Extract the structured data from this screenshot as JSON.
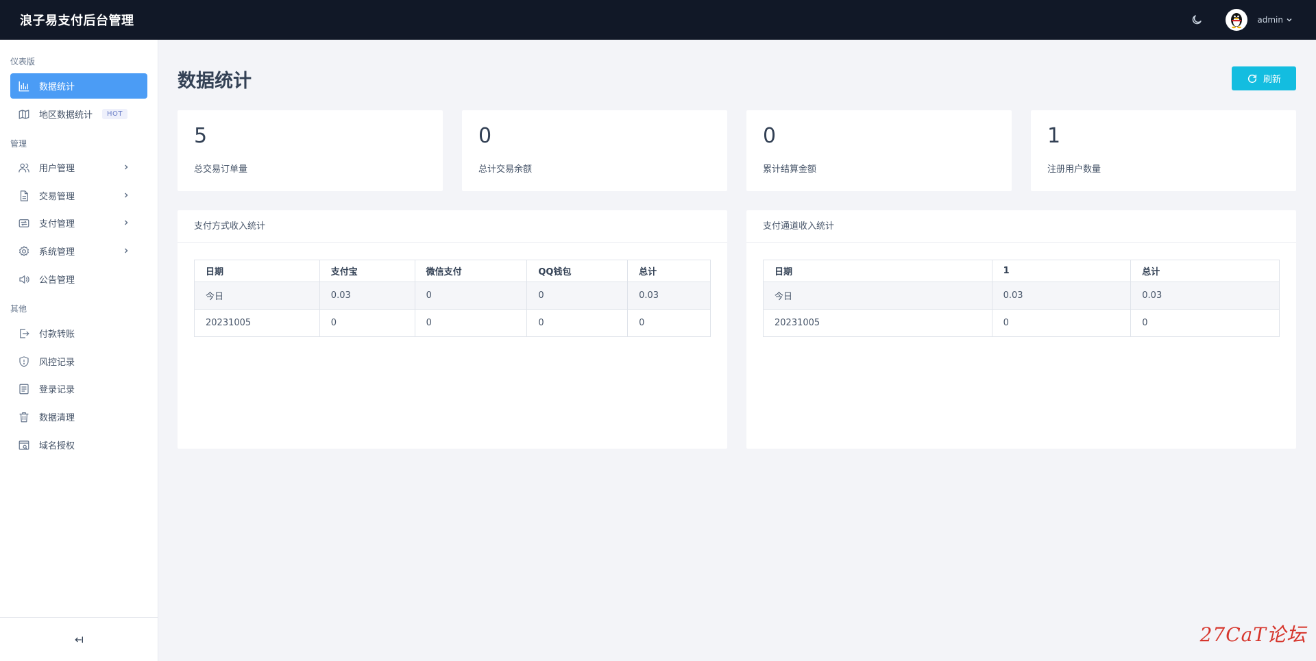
{
  "header": {
    "title": "浪子易支付后台管理",
    "user": "admin",
    "icons": {
      "theme": "moon-icon",
      "avatar": "penguin-avatar",
      "dropdown": "chevron-down-icon"
    }
  },
  "sidebar": {
    "sections": [
      "仪表版",
      "管理",
      "其他"
    ],
    "items": [
      {
        "label": "数据统计",
        "icon": "bar-chart-icon",
        "active": true
      },
      {
        "label": "地区数据统计",
        "icon": "map-icon",
        "badge": "HOT"
      },
      {
        "label": "用户管理",
        "icon": "users-icon",
        "expandable": true
      },
      {
        "label": "交易管理",
        "icon": "document-icon",
        "expandable": true
      },
      {
        "label": "支付管理",
        "icon": "transfer-icon",
        "expandable": true
      },
      {
        "label": "系统管理",
        "icon": "gear-icon",
        "expandable": true
      },
      {
        "label": "公告管理",
        "icon": "speaker-icon"
      },
      {
        "label": "付款转账",
        "icon": "export-icon"
      },
      {
        "label": "风控记录",
        "icon": "shield-icon"
      },
      {
        "label": "登录记录",
        "icon": "list-icon"
      },
      {
        "label": "数据清理",
        "icon": "trash-icon"
      },
      {
        "label": "域名授权",
        "icon": "domain-icon"
      }
    ],
    "collapse_icon": "collapse-left-icon"
  },
  "main": {
    "title": "数据统计",
    "refresh_label": "刷新",
    "stats": [
      {
        "value": "5",
        "label": "总交易订单量"
      },
      {
        "value": "0",
        "label": "总计交易余额"
      },
      {
        "value": "0",
        "label": "累计结算金额"
      },
      {
        "value": "1",
        "label": "注册用户数量"
      }
    ],
    "payment_method_table": {
      "title": "支付方式收入统计",
      "columns": [
        "日期",
        "支付宝",
        "微信支付",
        "QQ钱包",
        "总计"
      ],
      "rows": [
        [
          "今日",
          "0.03",
          "0",
          "0",
          "0.03"
        ],
        [
          "20231005",
          "0",
          "0",
          "0",
          "0"
        ]
      ]
    },
    "channel_table": {
      "title": "支付通道收入统计",
      "columns": [
        "日期",
        "1",
        "总计"
      ],
      "rows": [
        [
          "今日",
          "0.03",
          "0.03"
        ],
        [
          "20231005",
          "0",
          "0"
        ]
      ]
    }
  },
  "watermark": "27CaT论坛",
  "colors": {
    "topbar": "#111827",
    "active_nav": "#4b9cf5",
    "refresh_button": "#13bde0",
    "watermark": "#d6352c"
  }
}
